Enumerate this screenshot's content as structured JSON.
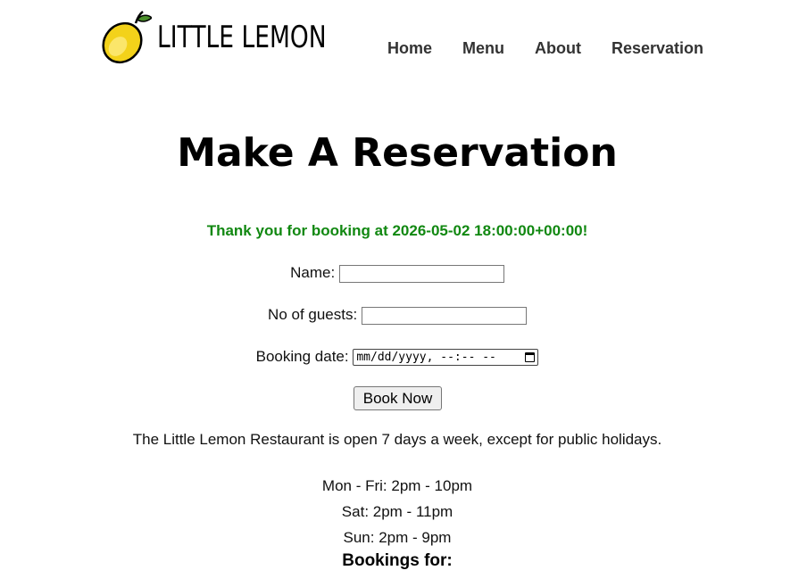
{
  "brand": {
    "name": "LITTLE LEMON",
    "logo_icon": "lemon-icon",
    "colors": {
      "lemon": "#F3D21A",
      "leaf": "#4A8F2A"
    }
  },
  "nav": {
    "items": [
      {
        "label": "Home"
      },
      {
        "label": "Menu"
      },
      {
        "label": "About"
      },
      {
        "label": "Reservation"
      }
    ]
  },
  "page": {
    "title": "Make A Reservation",
    "confirmation": "Thank you for booking at 2026-05-02 18:00:00+00:00!",
    "confirmation_color": "#118811"
  },
  "form": {
    "name_label": "Name:",
    "name_value": "",
    "guests_label": "No of guests:",
    "guests_value": "",
    "date_label": "Booking date:",
    "date_placeholder": "mm/dd/yyyy, --:-- --",
    "submit_label": "Book Now"
  },
  "info": {
    "open_text": "The Little Lemon Restaurant is open 7 days a week, except for public holidays.",
    "hours": [
      "Mon - Fri: 2pm - 10pm",
      "Sat: 2pm - 11pm",
      "Sun: 2pm - 9pm"
    ],
    "bookings_heading": "Bookings for:"
  }
}
